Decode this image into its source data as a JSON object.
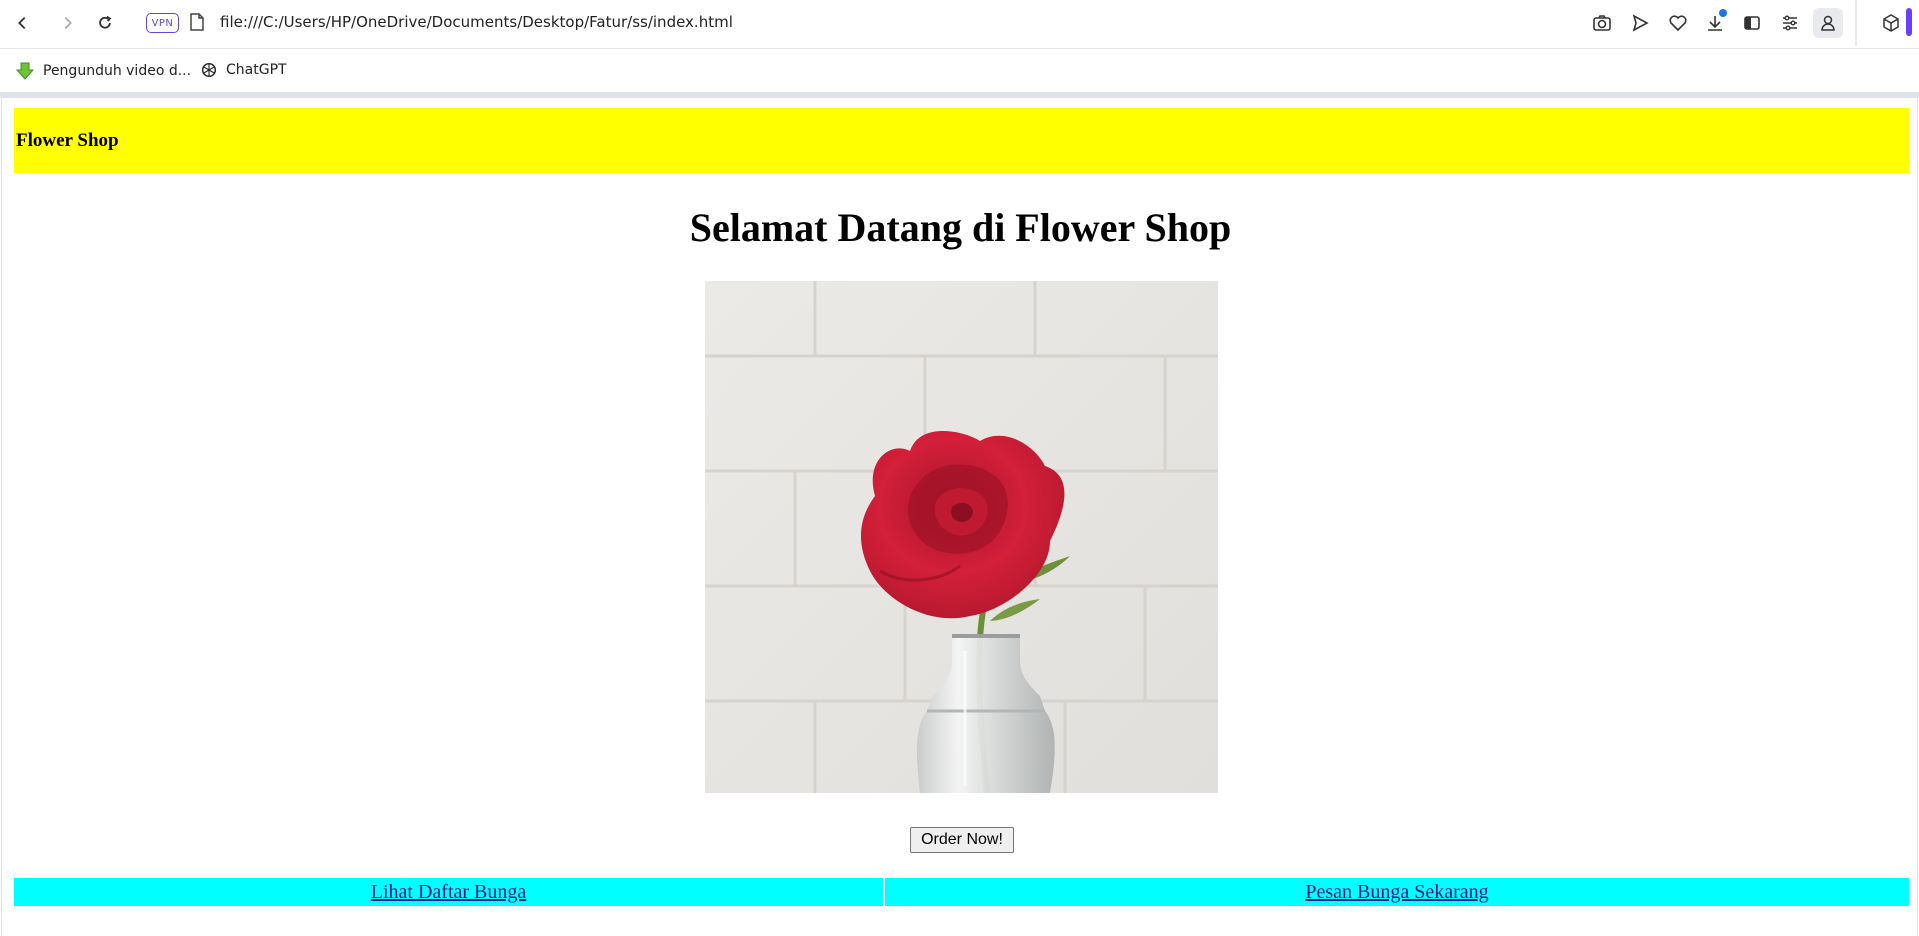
{
  "browser": {
    "vpn_label": "VPN",
    "url": "file:///C:/Users/HP/OneDrive/Documents/Desktop/Fatur/ss/index.html",
    "bookmarks": [
      {
        "label": "Pengunduh video d..."
      },
      {
        "label": "ChatGPT"
      }
    ]
  },
  "page": {
    "header_title": "Flower Shop",
    "welcome": "Selamat Datang di Flower Shop",
    "order_button": "Order Now!",
    "nav_links": [
      {
        "label": "Lihat Daftar Bunga"
      },
      {
        "label": "Pesan Bunga Sekarang"
      }
    ]
  },
  "colors": {
    "header_bg": "#ffff00",
    "nav_bg": "#00ffff",
    "accent": "#6c3cff"
  }
}
